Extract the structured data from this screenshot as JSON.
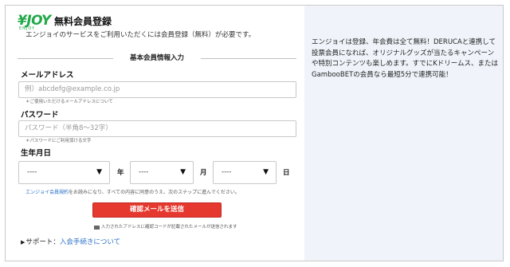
{
  "logo": {
    "mark": "¥JOY",
    "sub": "ENJOY"
  },
  "header": {
    "title": "無料会員登録",
    "subtitle": "エンジョイのサービスをご利用いただくには会員登録（無料）が必要です。"
  },
  "form": {
    "section_label": "基本会員情報入力",
    "email": {
      "label": "メールアドレス",
      "placeholder": "例）abcdefg@example.co.jp",
      "hint": "＊ご使用いただけるメールアドレスについて"
    },
    "password": {
      "label": "パスワード",
      "placeholder": "パスワード（半角8〜32字）",
      "hint": "＊パスワードにご利用頂ける文字"
    },
    "birthdate": {
      "label": "生年月日",
      "year_value": "----",
      "year_unit": "年",
      "month_value": "----",
      "month_unit": "月",
      "day_value": "----",
      "day_unit": "日",
      "arrow": "▼"
    },
    "agree": {
      "link": "エンジョイ会員規約",
      "text": "をお読みになり、すべての内容に同意のうえ、次のステップに進んでください。"
    },
    "submit_label": "確認メールを送信",
    "notice": "入力されたアドレスに確認コードが記載されたメールが送信されます"
  },
  "support": {
    "prefix": "▶",
    "label": "サポート：",
    "link": "入会手続きについて"
  },
  "info_panel": {
    "text": "エンジョイは登録、年会費は全て無料！DERUCAと連携して投票会員になれば、オリジナルグッズが当たるキャンペーンや特別コンテンツも楽しめます。すでにKドリームス、またはGambooBETの会員なら最短5分で連携可能！"
  },
  "colors": {
    "brand_green": "#23a84a",
    "submit_red": "#e5382e",
    "link_blue": "#2a6fc7",
    "panel_bg": "#f0f4fa"
  }
}
